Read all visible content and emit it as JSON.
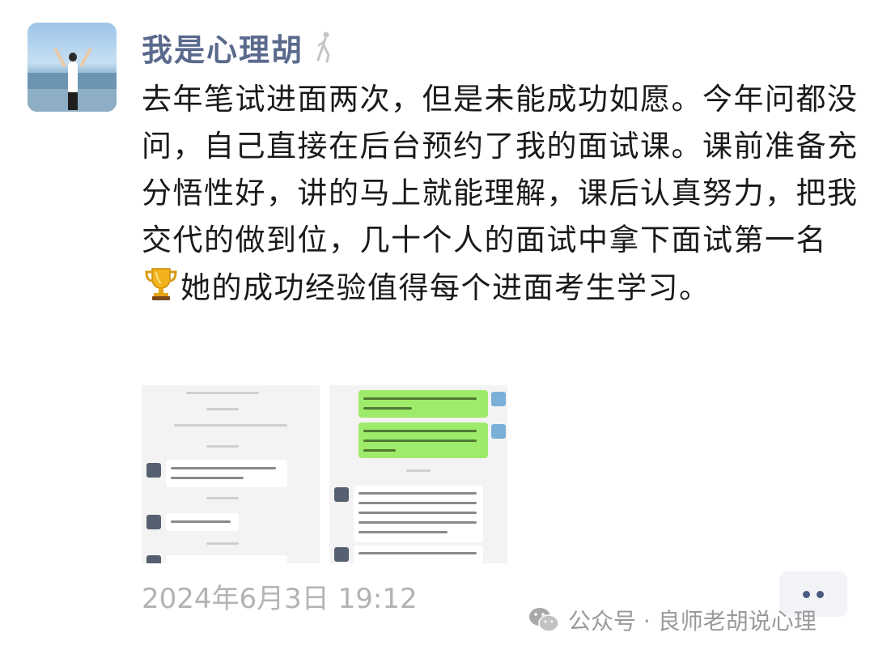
{
  "post": {
    "author": "我是心理胡",
    "text_part1": "去年笔试进面两次，但是未能成功如愿。今年问都没问，自己直接在后台预约了我的面试课。课前准备充分悟性好，讲的马上就能理解，课后认真努力，把我交代的做到位，几十个人的面试中拿下面试第一名",
    "text_part2": "她的成功经验值得每个进面考生学习。",
    "timestamp": "2024年6月3日 19:12"
  },
  "watermark": {
    "text": "公众号 · 良师老胡说心理"
  },
  "icons": {
    "avatar": "person-arms-raised-beach",
    "name_tag": "walking-person-icon",
    "inline_emoji": "trophy-icon",
    "more": "more-dots-icon",
    "watermark": "wechat-icon"
  },
  "colors": {
    "name": "#5a6a8c",
    "text": "#1a1a1a",
    "timestamp": "#b3b3b3",
    "chat_green": "#9eea6a"
  }
}
